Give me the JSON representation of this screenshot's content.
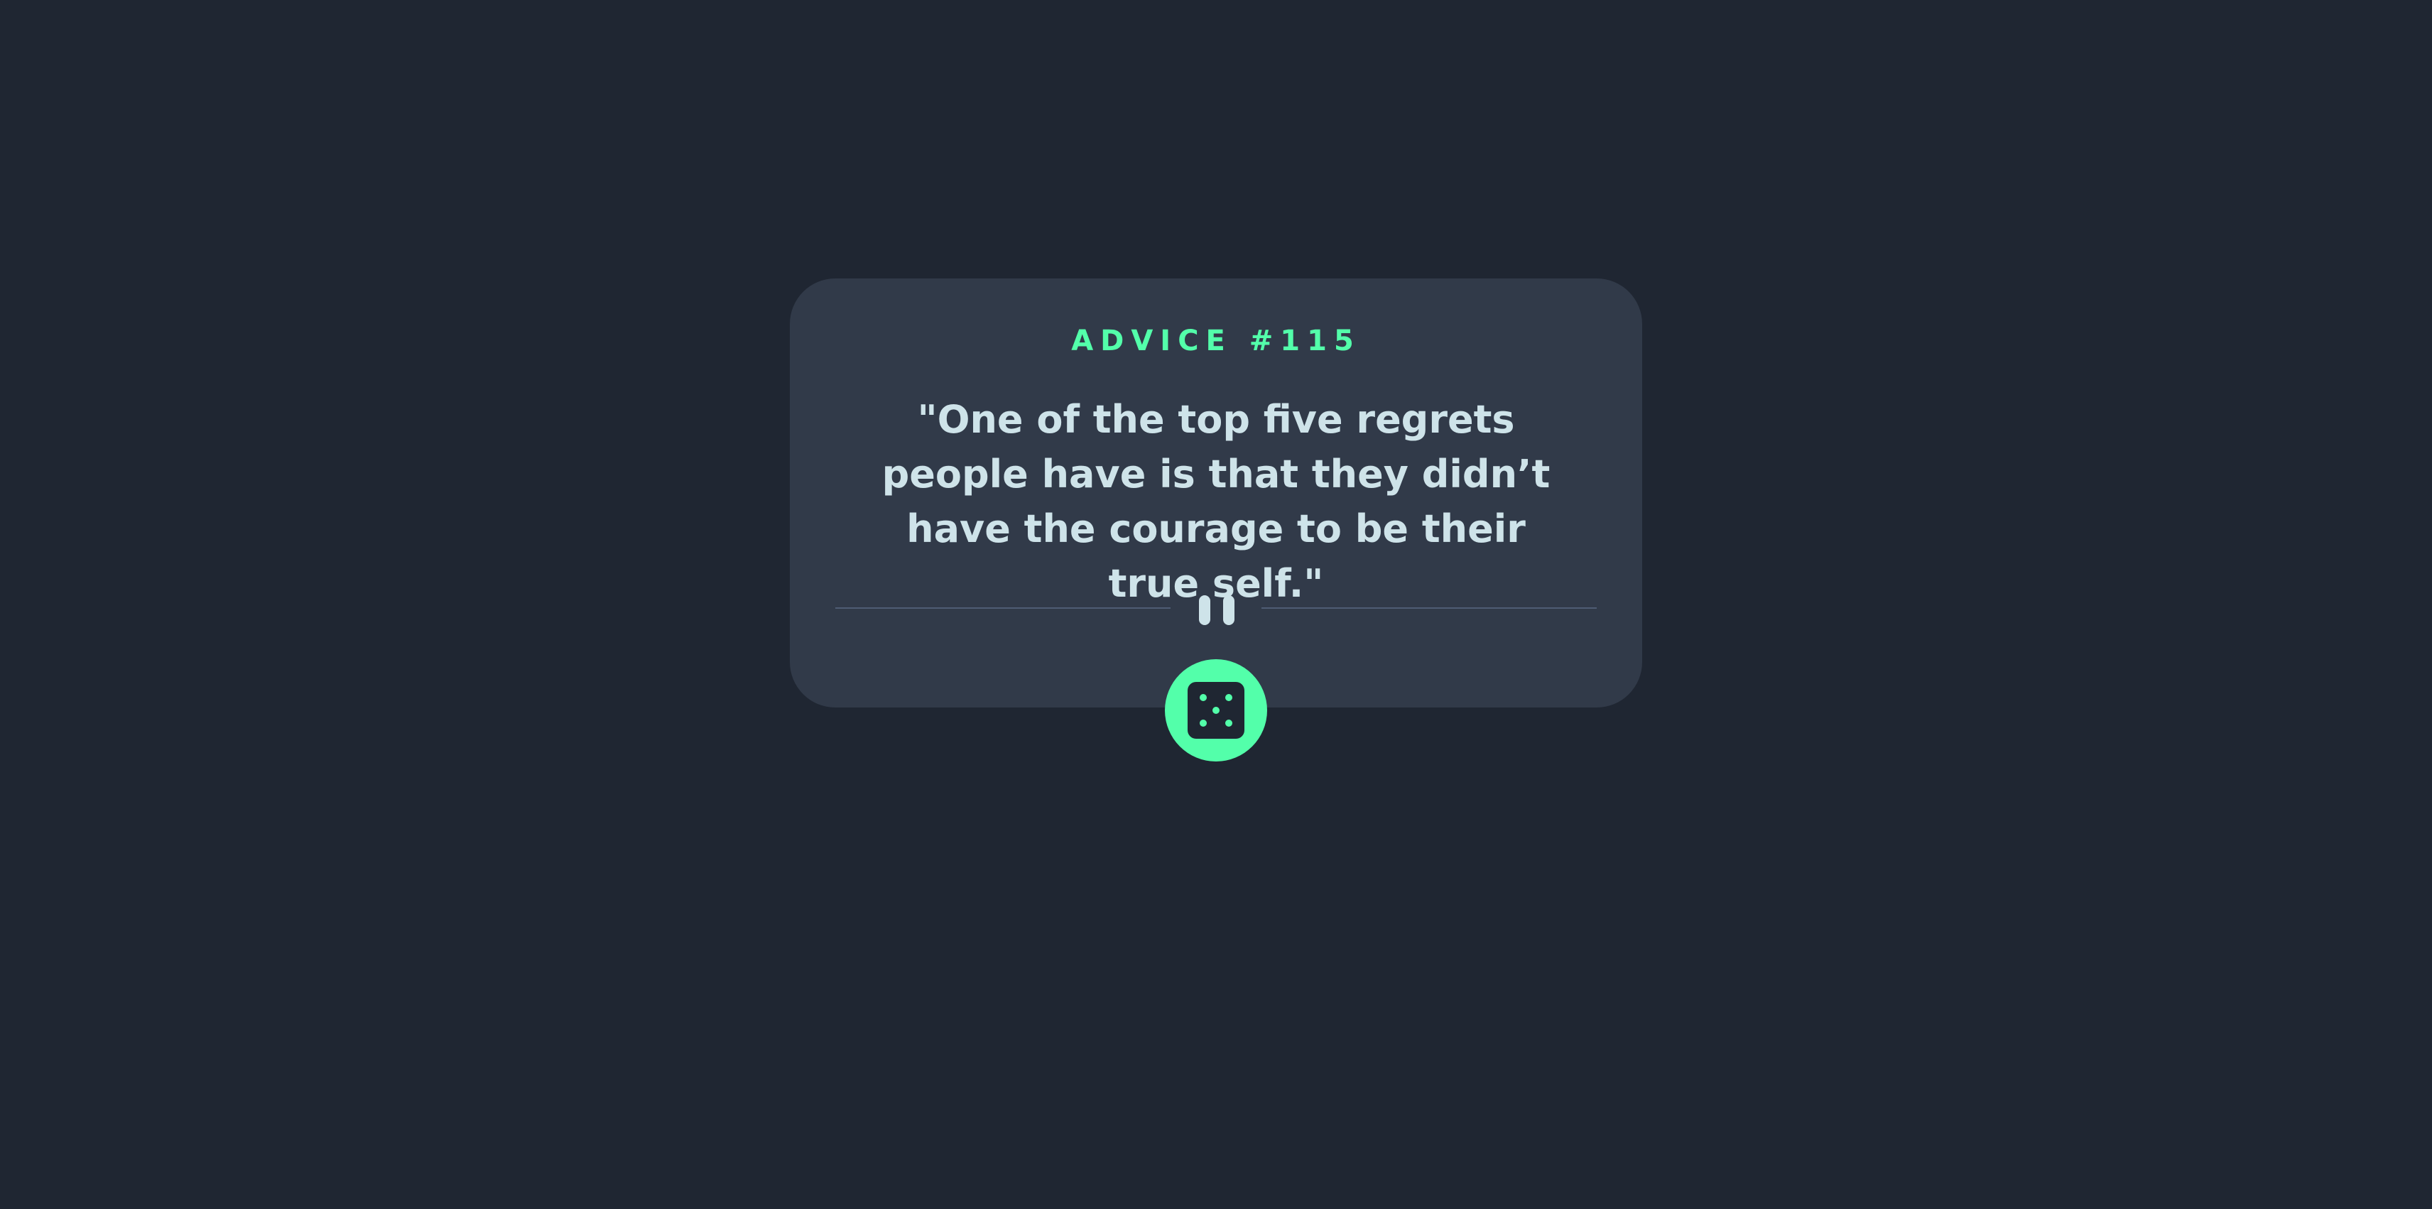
{
  "card": {
    "title": "ADVICE #115",
    "advice": "\"One of the top five regrets people have is that they didn’t have the courage to be their true self.\""
  },
  "colors": {
    "background": "#1f2632",
    "card": "#313a49",
    "accent": "#53ffaa",
    "text": "#cee3e9",
    "divider": "#4f5d74"
  },
  "icons": {
    "divider": "pause-icon",
    "button": "dice-icon"
  }
}
